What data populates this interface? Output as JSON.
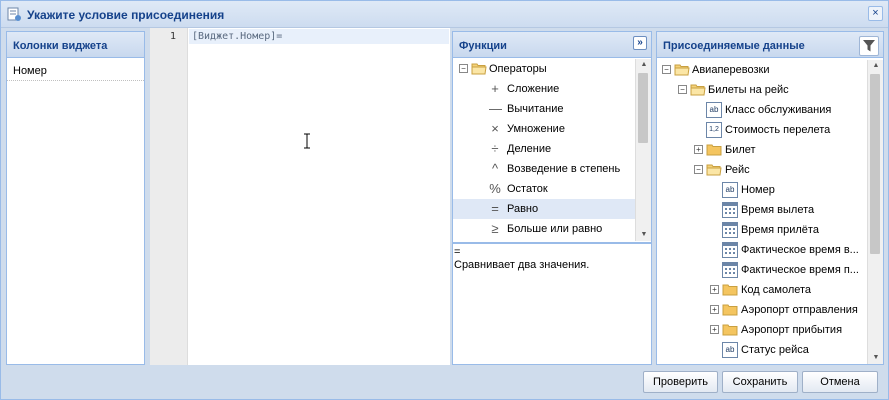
{
  "window": {
    "title": "Укажите условие присоединения",
    "close_label": "×"
  },
  "columns": {
    "header": "Колонки виджета",
    "items": [
      "Номер"
    ]
  },
  "editor": {
    "line_number": "1",
    "code": "[Виджет.Номер]="
  },
  "functions": {
    "header": "Функции",
    "expand_label": "»",
    "group_toggle": "−",
    "group": "Операторы",
    "items": [
      {
        "symbol": "+",
        "label": "Сложение"
      },
      {
        "symbol": "—",
        "label": "Вычитание"
      },
      {
        "symbol": "×",
        "label": "Умножение"
      },
      {
        "symbol": "÷",
        "label": "Деление"
      },
      {
        "symbol": "^",
        "label": "Возведение в степень"
      },
      {
        "symbol": "%",
        "label": "Остаток"
      },
      {
        "symbol": "=",
        "label": "Равно"
      },
      {
        "symbol": "≥",
        "label": "Больше или равно"
      }
    ],
    "selected": "Равно",
    "description_title": "=",
    "description": "Сравнивает два значения."
  },
  "data": {
    "header": "Присоединяемые данные",
    "tree": [
      {
        "label": "Авиаперевозки",
        "type": "folder-open",
        "toggle": "−",
        "level": 0
      },
      {
        "label": "Билеты на рейс",
        "type": "folder-open",
        "toggle": "−",
        "level": 1
      },
      {
        "label": "Класс обслуживания",
        "type": "text-field",
        "icon_text": "ab",
        "level": 2
      },
      {
        "label": "Стоимость перелета",
        "type": "number-field",
        "icon_text": "1,2",
        "level": 2
      },
      {
        "label": "Билет",
        "type": "folder",
        "toggle": "+",
        "level": 2
      },
      {
        "label": "Рейс",
        "type": "folder-open",
        "toggle": "−",
        "level": 2
      },
      {
        "label": "Номер",
        "type": "text-field",
        "icon_text": "ab",
        "level": 3
      },
      {
        "label": "Время вылета",
        "type": "date-field",
        "level": 3
      },
      {
        "label": "Время прилёта",
        "type": "date-field",
        "level": 3
      },
      {
        "label": "Фактическое время в...",
        "type": "date-field",
        "level": 3
      },
      {
        "label": "Фактическое время п...",
        "type": "date-field",
        "level": 3
      },
      {
        "label": "Код самолета",
        "type": "folder",
        "toggle": "+",
        "level": 3
      },
      {
        "label": "Аэропорт отправления",
        "type": "folder",
        "toggle": "+",
        "level": 3
      },
      {
        "label": "Аэропорт прибытия",
        "type": "folder",
        "toggle": "+",
        "level": 3
      },
      {
        "label": "Статус рейса",
        "type": "text-field",
        "icon_text": "ab",
        "level": 3
      }
    ]
  },
  "buttons": {
    "check": "Проверить",
    "save": "Сохранить",
    "cancel": "Отмена"
  }
}
